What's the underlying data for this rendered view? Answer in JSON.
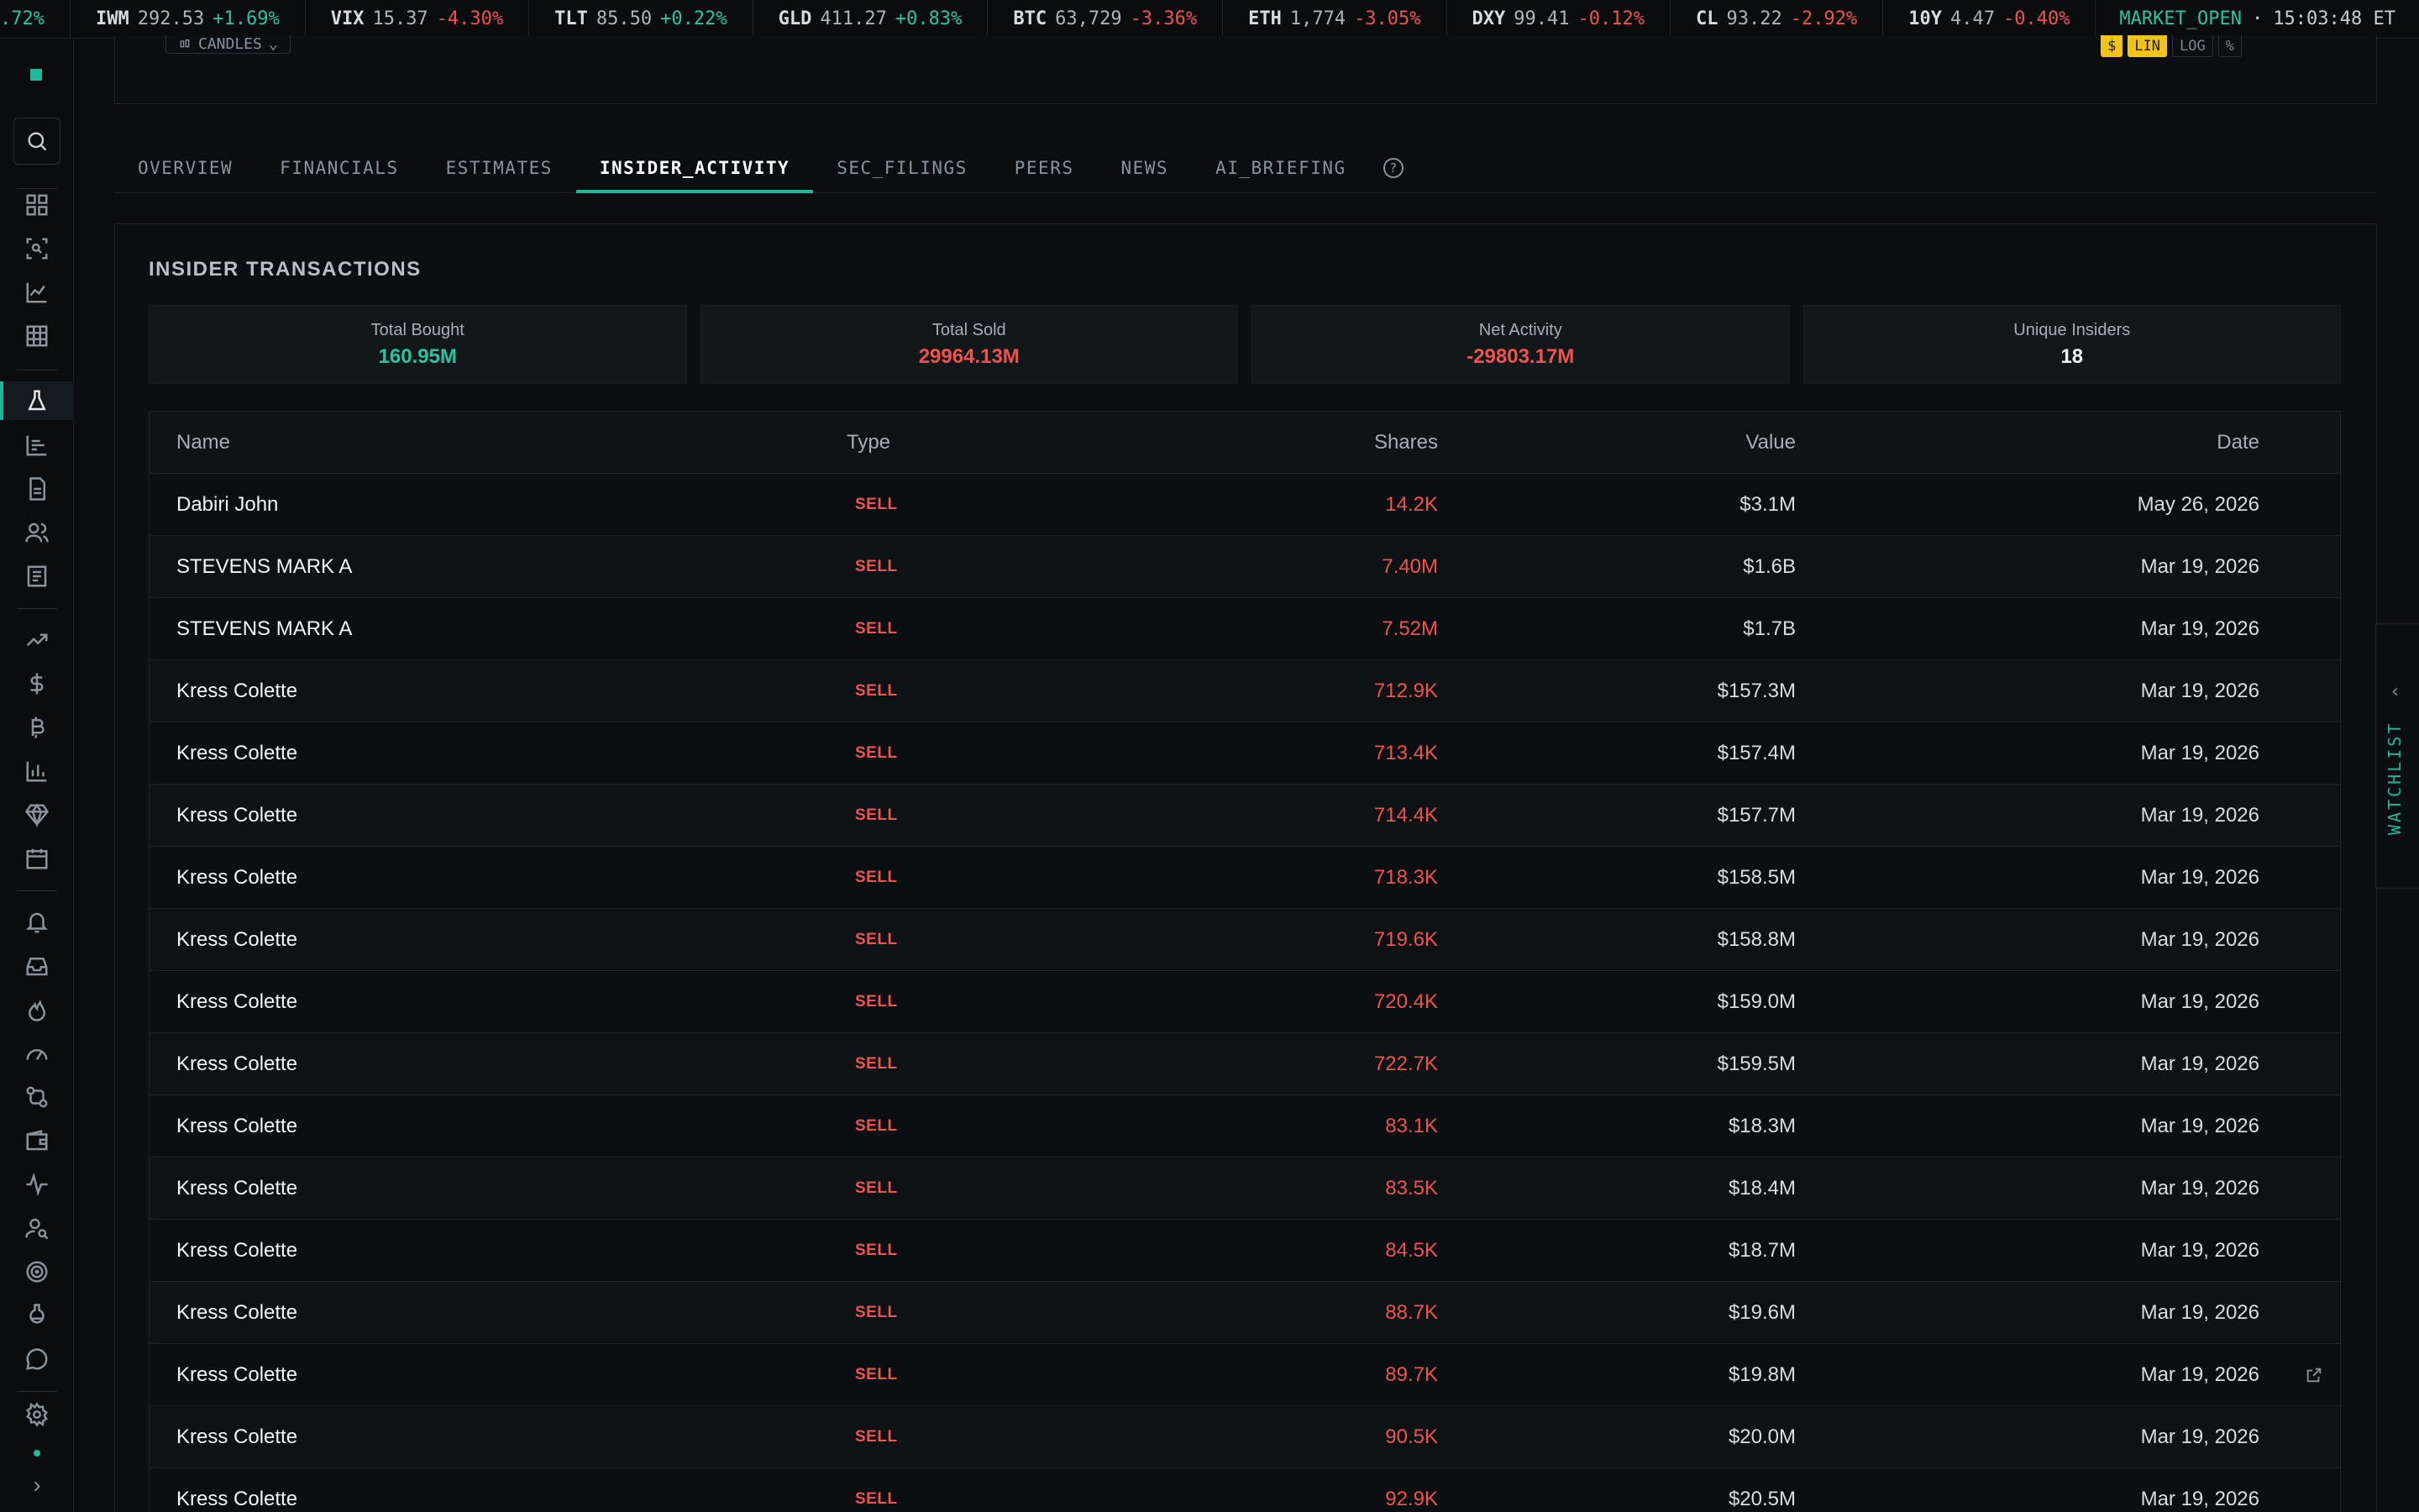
{
  "ticker": {
    "items": [
      {
        "sym": "",
        "price": "",
        "chg": ".72%",
        "dir": "up"
      },
      {
        "sym": "IWM",
        "price": "292.53",
        "chg": "+1.69%",
        "dir": "up"
      },
      {
        "sym": "VIX",
        "price": "15.37",
        "chg": "-4.30%",
        "dir": "dn"
      },
      {
        "sym": "TLT",
        "price": "85.50",
        "chg": "+0.22%",
        "dir": "up"
      },
      {
        "sym": "GLD",
        "price": "411.27",
        "chg": "+0.83%",
        "dir": "up"
      },
      {
        "sym": "BTC",
        "price": "63,729",
        "chg": "-3.36%",
        "dir": "dn"
      },
      {
        "sym": "ETH",
        "price": "1,774",
        "chg": "-3.05%",
        "dir": "dn"
      },
      {
        "sym": "DXY",
        "price": "99.41",
        "chg": "-0.12%",
        "dir": "dn"
      },
      {
        "sym": "CL",
        "price": "93.22",
        "chg": "-2.92%",
        "dir": "dn"
      },
      {
        "sym": "10Y",
        "price": "4.47",
        "chg": "-0.40%",
        "dir": "dn"
      }
    ],
    "market_status": "MARKET_OPEN",
    "separator": "·",
    "clock": "15:03:48 ET"
  },
  "chart_controls": {
    "candles_label": "CANDLES",
    "scale_dollar": "$",
    "scale_lin": "LIN",
    "scale_log": "LOG",
    "scale_pct": "%"
  },
  "tabs": [
    {
      "label": "OVERVIEW",
      "active": false
    },
    {
      "label": "FINANCIALS",
      "active": false
    },
    {
      "label": "ESTIMATES",
      "active": false
    },
    {
      "label": "INSIDER_ACTIVITY",
      "active": true
    },
    {
      "label": "SEC_FILINGS",
      "active": false
    },
    {
      "label": "PEERS",
      "active": false
    },
    {
      "label": "NEWS",
      "active": false
    },
    {
      "label": "AI_BRIEFING",
      "active": false
    }
  ],
  "help_glyph": "?",
  "insider": {
    "title": "INSIDER TRANSACTIONS",
    "stats": [
      {
        "label": "Total Bought",
        "value": "160.95M",
        "color": "green"
      },
      {
        "label": "Total Sold",
        "value": "29964.13M",
        "color": "red"
      },
      {
        "label": "Net Activity",
        "value": "-29803.17M",
        "color": "red"
      },
      {
        "label": "Unique Insiders",
        "value": "18",
        "color": "white"
      }
    ],
    "columns": {
      "name": "Name",
      "type": "Type",
      "shares": "Shares",
      "value": "Value",
      "date": "Date"
    },
    "rows": [
      {
        "name": "Dabiri John",
        "type": "SELL",
        "shares": "14.2K",
        "value": "$3.1M",
        "date": "May 26, 2026"
      },
      {
        "name": "STEVENS MARK A",
        "type": "SELL",
        "shares": "7.40M",
        "value": "$1.6B",
        "date": "Mar 19, 2026"
      },
      {
        "name": "STEVENS MARK A",
        "type": "SELL",
        "shares": "7.52M",
        "value": "$1.7B",
        "date": "Mar 19, 2026"
      },
      {
        "name": "Kress Colette",
        "type": "SELL",
        "shares": "712.9K",
        "value": "$157.3M",
        "date": "Mar 19, 2026"
      },
      {
        "name": "Kress Colette",
        "type": "SELL",
        "shares": "713.4K",
        "value": "$157.4M",
        "date": "Mar 19, 2026"
      },
      {
        "name": "Kress Colette",
        "type": "SELL",
        "shares": "714.4K",
        "value": "$157.7M",
        "date": "Mar 19, 2026"
      },
      {
        "name": "Kress Colette",
        "type": "SELL",
        "shares": "718.3K",
        "value": "$158.5M",
        "date": "Mar 19, 2026"
      },
      {
        "name": "Kress Colette",
        "type": "SELL",
        "shares": "719.6K",
        "value": "$158.8M",
        "date": "Mar 19, 2026"
      },
      {
        "name": "Kress Colette",
        "type": "SELL",
        "shares": "720.4K",
        "value": "$159.0M",
        "date": "Mar 19, 2026"
      },
      {
        "name": "Kress Colette",
        "type": "SELL",
        "shares": "722.7K",
        "value": "$159.5M",
        "date": "Mar 19, 2026"
      },
      {
        "name": "Kress Colette",
        "type": "SELL",
        "shares": "83.1K",
        "value": "$18.3M",
        "date": "Mar 19, 2026"
      },
      {
        "name": "Kress Colette",
        "type": "SELL",
        "shares": "83.5K",
        "value": "$18.4M",
        "date": "Mar 19, 2026"
      },
      {
        "name": "Kress Colette",
        "type": "SELL",
        "shares": "84.5K",
        "value": "$18.7M",
        "date": "Mar 19, 2026"
      },
      {
        "name": "Kress Colette",
        "type": "SELL",
        "shares": "88.7K",
        "value": "$19.6M",
        "date": "Mar 19, 2026"
      },
      {
        "name": "Kress Colette",
        "type": "SELL",
        "shares": "89.7K",
        "value": "$19.8M",
        "date": "Mar 19, 2026",
        "hover_link": true
      },
      {
        "name": "Kress Colette",
        "type": "SELL",
        "shares": "90.5K",
        "value": "$20.0M",
        "date": "Mar 19, 2026"
      },
      {
        "name": "Kress Colette",
        "type": "SELL",
        "shares": "92.9K",
        "value": "$20.5M",
        "date": "Mar 19, 2026"
      }
    ]
  },
  "watchlist": {
    "label": "WATCHLIST",
    "chevron": "‹"
  },
  "sidebar": {
    "icons": [
      "search-icon",
      "dashboard-icon",
      "screener-icon",
      "chart-icon",
      "grid-icon",
      "lab-icon",
      "bar-chart-icon",
      "document-icon",
      "users-icon",
      "news-icon",
      "trend-up-icon",
      "dollar-icon",
      "bitcoin-icon",
      "stats-icon",
      "diamond-icon",
      "calendar-icon",
      "bell-icon",
      "inbox-icon",
      "flame-icon",
      "gauge-icon",
      "swap-icon",
      "wallet-icon",
      "pulse-icon",
      "user-search-icon",
      "target-icon",
      "flask-icon",
      "chat-icon",
      "settings-icon",
      "status-dot-icon",
      "expand-icon"
    ],
    "expand_glyph": "›"
  },
  "colors": {
    "accent": "#1fb89a",
    "up": "#26c6a2",
    "down": "#ef5350",
    "highlight": "#f2c318"
  }
}
